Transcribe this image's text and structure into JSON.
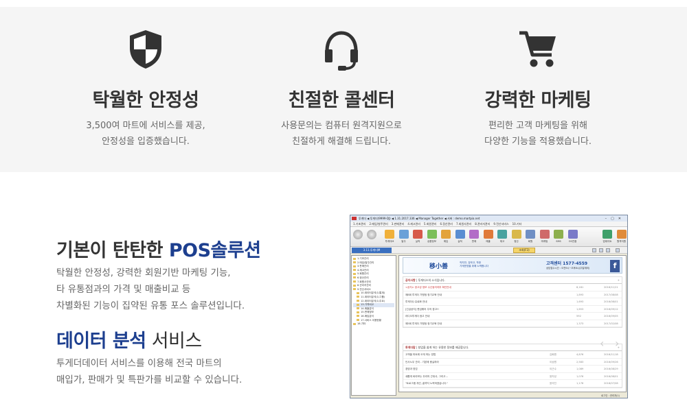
{
  "features": [
    {
      "icon": "shield-icon",
      "title": "탁월한 안정성",
      "line1": "3,500여 마트에 서비스를 제공,",
      "line2": "안정성을 입증했습니다."
    },
    {
      "icon": "headset-icon",
      "title": "친절한 콜센터",
      "line1": "사용문의는 컴퓨터 원격지원으로",
      "line2": "친절하게 해결해 드립니다."
    },
    {
      "icon": "cart-icon",
      "title": "강력한 마케팅",
      "line1": "편리한 고객 마케팅을 위해",
      "line2": "다양한 기능을 적용했습니다."
    }
  ],
  "pos": {
    "title_plain": "기본이 탄탄한 ",
    "title_highlight": "POS솔루션",
    "desc": [
      "탁월한 안정성, 강력한 회원기반 마케팅 기능,",
      "타 유통점과의 가격 및 매출비교 등",
      "차별화된 기능이 집약된 유통 포스 솔루션입니다."
    ]
  },
  "data_service": {
    "title_highlight": "데이터 분석",
    "title_plain": " 서비스",
    "desc": [
      "투게더데이터 서비스를 이용해 전국 마트의",
      "매입가, 판매가 및 특판가를 비교할 수 있습니다."
    ]
  },
  "app": {
    "title": "투게더 ◀ 투게더(9999-DJ) ◀ 1.31.2017.336 ◀ Manager Together ◀ 서버 : demo.martpia.net",
    "menu": [
      "1.기초관리",
      "2.매입/발주관리",
      "3.판매관리",
      "4.재고관리",
      "5.회원관리",
      "6.정산관리",
      "7.회원사관리",
      "8.관리자관리",
      "9.전산서비스",
      "10.기타"
    ],
    "toolbar": [
      "투게더M",
      "발주",
      "실적",
      "상품정보",
      "매입",
      "실적",
      "판매",
      "매출",
      "재고",
      "정산",
      "회원",
      "마케팅",
      "SMS",
      "OS연결",
      "업데이트",
      "원격지원",
      "투게더",
      "종료"
    ],
    "version_badge": "3.11.투게더M",
    "search_label": "조회(F3)",
    "tree": [
      "1.기초관리",
      "2.매입/발주관리",
      "3.판매관리",
      "4.재고관리",
      "5.회원관리",
      "6.정산관리",
      "7.회원사관리",
      "8.관리자관리",
      "9.전산서비스",
      "10.데이터분석(1/통계)",
      "11.데이터분석(1/그룹)",
      "12.데이터분석(1/주요)",
      "13.가격비교",
      "14.매출분석",
      "15.판매정보",
      "16.매입분석",
      "17.서비스 이용현황",
      "18.기타"
    ],
    "banner": {
      "brand": "移小善",
      "slogan1": "작지만, 강하고, 착한",
      "slogan2": "가게운영을 위해 노력합니다",
      "cs_title": "고객센터 1577-4559",
      "cs_sub": "상담접수시간 : 오전9시~오후6시(주말제외)",
      "fb": "f"
    },
    "notice": {
      "title": "공지사항",
      "sub": "투게더스의 소식입니다.",
      "rows": [
        {
          "text": "<공지> 광고성 정보 수신동의여부 확인안내",
          "c2": "",
          "c3": "8,181",
          "c4": "2016/11/21",
          "red": true
        },
        {
          "text": "제8회 투게더 가맹점 정기교육 안내",
          "c2": "",
          "c3": "1,893",
          "c4": "2017/08/08",
          "red": false
        },
        {
          "text": "투게더Q 유료화 안내",
          "c2": "",
          "c3": "1,693",
          "c4": "2016/08/01",
          "red": false
        },
        {
          "text": "[긴급공지] 랜섬웨어 주의 경고!!",
          "c2": "",
          "c3": "1,653",
          "c4": "2016/09/12",
          "red": false
        },
        {
          "text": "라디오투게더 광고 안내",
          "c2": "",
          "c3": "592",
          "c4": "2016/09/05",
          "red": false
        },
        {
          "text": "제5회 투게더 가맹점 정기교육 안내",
          "c2": "",
          "c3": "1,373",
          "c4": "2017/02/08",
          "red": false
        }
      ]
    },
    "qna": {
      "title": "투게더맘",
      "sub": "창업을 쉽게 하는 유용한 정보를 제공합니다.",
      "rows": [
        {
          "text": "고객을 마트에 오게 하는 방법",
          "c2": "김회원",
          "c3": "4,876",
          "c4": "2016/11/18"
        },
        {
          "text": "인사노무 관리 - 기본에 충실하라",
          "c2": "이상원",
          "c3": "2,583",
          "c4": "2016/09/26"
        },
        {
          "text": "경영과 영업",
          "c2": "이근수",
          "c3": "1,089",
          "c4": "2016/08/29"
        },
        {
          "text": "새롭게 바라보는 우리의 근대사, 그리고...",
          "c2": "윤지성",
          "c3": "1,076",
          "c4": "2016/08/01"
        },
        {
          "text": "\"트로그램 개선, 끝까지 노력하겠습니다.\"",
          "c2": "윤석진",
          "c3": "1,176",
          "c4": "2016/07/08"
        }
      ]
    },
    "status": "로그인 : 관리자(1)"
  }
}
